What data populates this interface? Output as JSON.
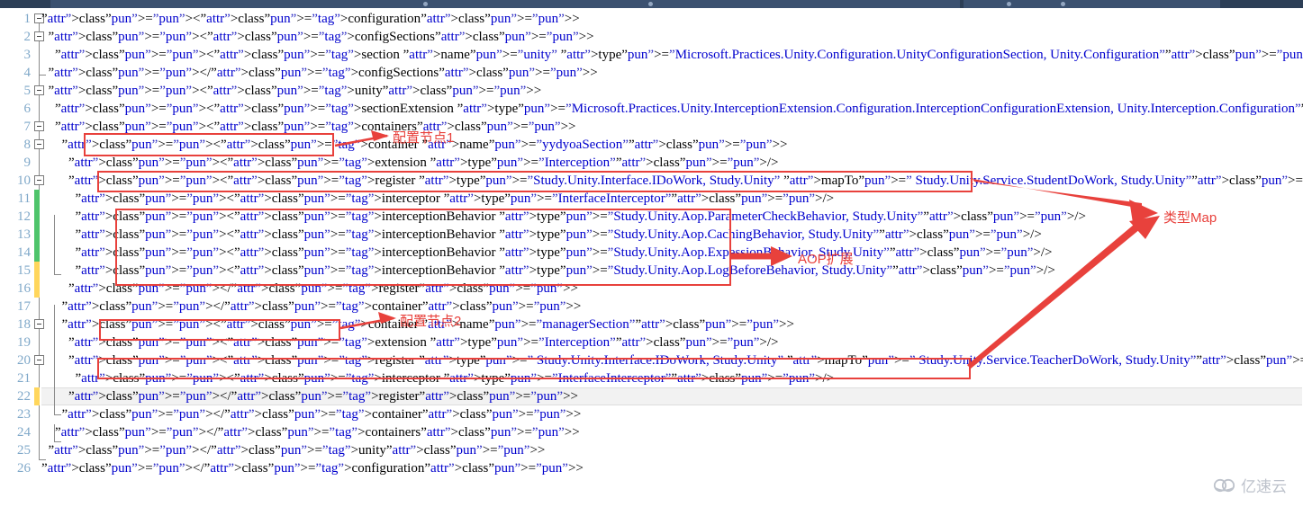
{
  "window": {
    "title_bar_color": "#2c3e56"
  },
  "editor": {
    "accent_line_number_color": "#7fa8c9",
    "current_line": 22,
    "lines": [
      {
        "n": 1,
        "text": "<configuration>"
      },
      {
        "n": 2,
        "text": "  <configSections>"
      },
      {
        "n": 3,
        "text": "    <section name=\"unity\" type=\"Microsoft.Practices.Unity.Configuration.UnityConfigurationSection, Unity.Configuration\"/>"
      },
      {
        "n": 4,
        "text": "  </configSections>"
      },
      {
        "n": 5,
        "text": "  <unity>"
      },
      {
        "n": 6,
        "text": "    <sectionExtension type=\"Microsoft.Practices.Unity.InterceptionExtension.Configuration.InterceptionConfigurationExtension, Unity.Interception.Configuration\"/>"
      },
      {
        "n": 7,
        "text": "    <containers>"
      },
      {
        "n": 8,
        "text": "      <container name=\"yydyoaSection\">"
      },
      {
        "n": 9,
        "text": "        <extension type=\"Interception\"/>"
      },
      {
        "n": 10,
        "text": "        <register type=\"Study.Unity.Interface.IDoWork, Study.Unity\" mapTo=\" Study.Unity.Service.StudentDoWork, Study.Unity\">"
      },
      {
        "n": 11,
        "text": "          <interceptor type=\"InterfaceInterceptor\"/>"
      },
      {
        "n": 12,
        "text": "          <interceptionBehavior type=\"Study.Unity.Aop.ParameterCheckBehavior, Study.Unity\"/>"
      },
      {
        "n": 13,
        "text": "          <interceptionBehavior type=\"Study.Unity.Aop.CachingBehavior, Study.Unity\"/>"
      },
      {
        "n": 14,
        "text": "          <interceptionBehavior type=\"Study.Unity.Aop.ExpessionBehavior, Study.Unity\"/>"
      },
      {
        "n": 15,
        "text": "          <interceptionBehavior type=\"Study.Unity.Aop.LogBeforeBehavior, Study.Unity\"/>"
      },
      {
        "n": 16,
        "text": "        </register>"
      },
      {
        "n": 17,
        "text": "      </container>"
      },
      {
        "n": 18,
        "text": "      <container name=\"managerSection\">"
      },
      {
        "n": 19,
        "text": "        <extension type=\"Interception\"/>"
      },
      {
        "n": 20,
        "text": "        <register type=\" Study.Unity.Interface.IDoWork, Study.Unity\" mapTo=\" Study.Unity.Service.TeacherDoWork, Study.Unity\">"
      },
      {
        "n": 21,
        "text": "          <interceptor type=\"InterfaceInterceptor\"/>"
      },
      {
        "n": 22,
        "text": "        </register>"
      },
      {
        "n": 23,
        "text": "      </container>"
      },
      {
        "n": 24,
        "text": "    </containers>"
      },
      {
        "n": 25,
        "text": "  </unity>"
      },
      {
        "n": 26,
        "text": "</configuration>"
      }
    ],
    "change_markers": [
      {
        "type": "green",
        "from_line": 11,
        "to_line": 14,
        "color": "#4ec46b"
      },
      {
        "type": "yellow",
        "from_line": 15,
        "to_line": 16,
        "color": "#ffd65c"
      },
      {
        "type": "yellow",
        "from_line": 22,
        "to_line": 22,
        "color": "#ffd65c"
      }
    ]
  },
  "annotations": {
    "color": "#e8413c",
    "labels": [
      {
        "id": "config-node-1",
        "text": "配置节点1"
      },
      {
        "id": "aop-extension",
        "text": "AOP扩展"
      },
      {
        "id": "type-map",
        "text": "类型Map"
      },
      {
        "id": "config-node-2",
        "text": "配置节点2"
      }
    ]
  },
  "watermark": {
    "text": "亿速云",
    "icon": "cloud-icon",
    "color": "#b6bcc6"
  }
}
